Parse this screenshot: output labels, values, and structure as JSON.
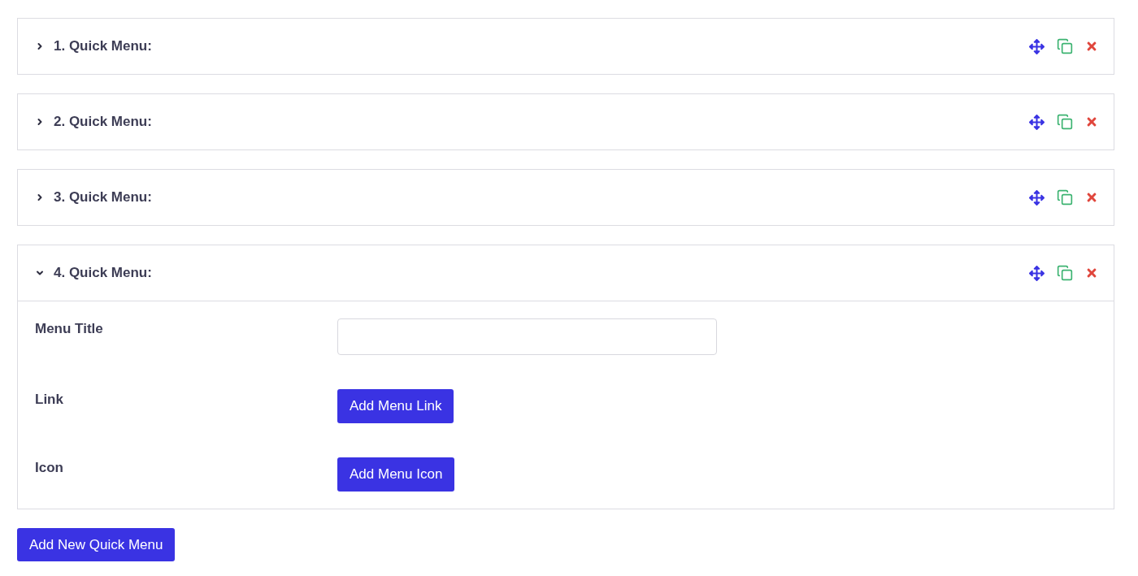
{
  "menus": [
    {
      "title": "1. Quick Menu:",
      "expanded": false
    },
    {
      "title": "2. Quick Menu:",
      "expanded": false
    },
    {
      "title": "3. Quick Menu:",
      "expanded": false
    },
    {
      "title": "4. Quick Menu:",
      "expanded": true,
      "fields": [
        {
          "kind": "input",
          "label": "Menu Title"
        },
        {
          "kind": "button",
          "label": "Link",
          "button": "Add Menu Link"
        },
        {
          "kind": "button",
          "label": "Icon",
          "button": "Add Menu Icon"
        }
      ]
    }
  ],
  "add_button": "Add New Quick Menu"
}
